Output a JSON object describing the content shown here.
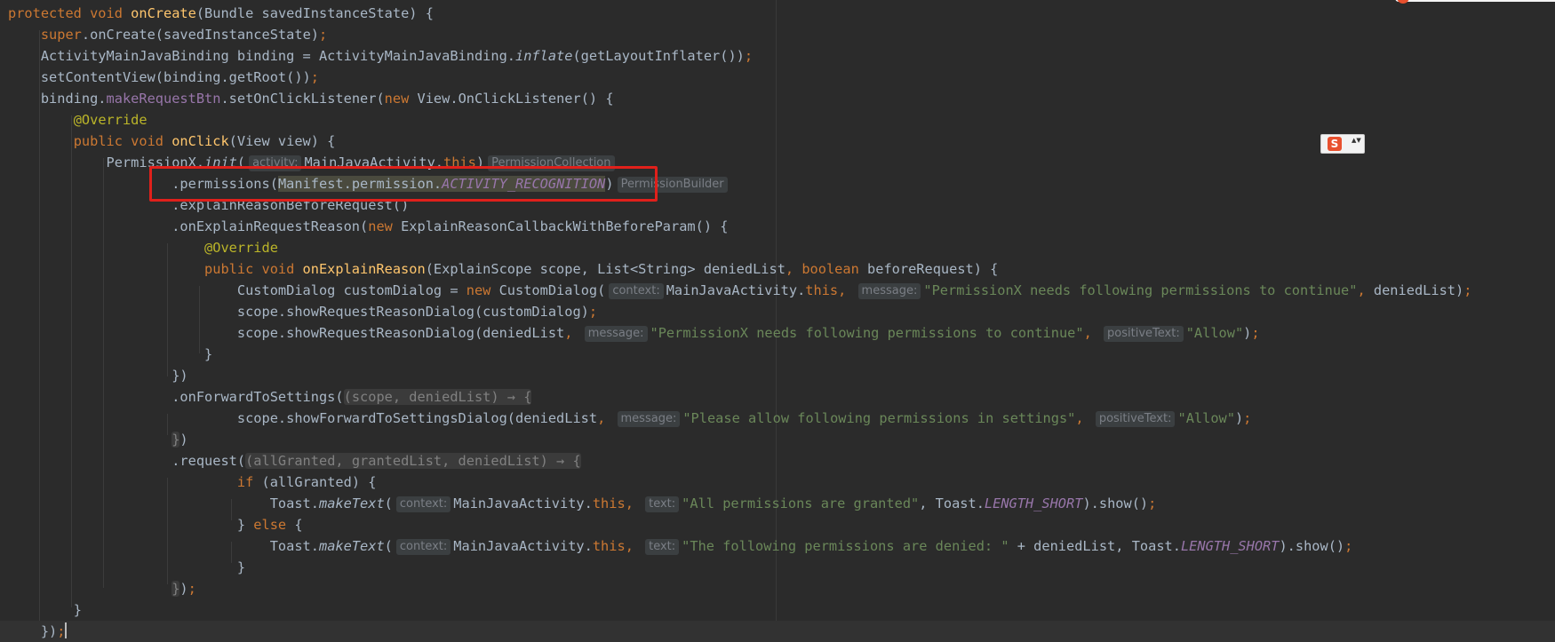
{
  "colors": {
    "background": "#2b2b2b",
    "keyword": "#cc7832",
    "method_declaration": "#ffc66d",
    "annotation": "#bbb529",
    "string": "#6a8759",
    "field": "#9876aa",
    "default_text": "#a9b7c6",
    "highlight_box": "#e0201b"
  },
  "code": {
    "l1": {
      "kw": "protected void ",
      "fn": "onCreate",
      "rest": "(Bundle savedInstanceState) {"
    },
    "l2": {
      "kw": "super",
      "rest": ".onCreate(savedInstanceState)",
      "semi": ";"
    },
    "l3": {
      "a": "ActivityMainJavaBinding binding = ActivityMainJavaBinding.",
      "it": "inflate",
      "b": "(getLayoutInflater())",
      "semi": ";"
    },
    "l4": {
      "a": "setContentView(binding.getRoot())",
      "semi": ";"
    },
    "l5": {
      "a": "binding.",
      "fld": "makeRequestBtn",
      "b": ".setOnClickListener(",
      "kw": "new ",
      "c": "View.OnClickListener() {"
    },
    "l6": {
      "ann": "@Override"
    },
    "l7": {
      "kw": "public void ",
      "fn": "onClick",
      "rest": "(View view) {"
    },
    "l8": {
      "a": "PermissionX.",
      "it": "init",
      "b": "(",
      "hint": "activity:",
      "c": "MainJavaActivity.",
      "kw": "this",
      "d": ")",
      "hint2": "PermissionCollection"
    },
    "l9": {
      "a": ".permissions(",
      "hl1": "Manifest.permission.",
      "cst": "ACTIVITY_RECOGNITION",
      "b": ")",
      "hint": "PermissionBuilder"
    },
    "l10": {
      "a": ".explainReasonBeforeRequest()"
    },
    "l11": {
      "a": ".onExplainRequestReason(",
      "kw": "new ",
      "b": "ExplainReasonCallbackWithBeforeParam() {"
    },
    "l12": {
      "ann": "@Override"
    },
    "l13": {
      "kw": "public void ",
      "fn": "onExplainReason",
      "a": "(ExplainScope scope, List<String> deniedList",
      "comma": ", ",
      "kw2": "boolean ",
      "b": "beforeRequest) {"
    },
    "l14": {
      "a": "CustomDialog customDialog = ",
      "kw": "new ",
      "b": "CustomDialog(",
      "hint": "context:",
      "c": "MainJavaActivity.",
      "kw2": "this",
      "comma": ", ",
      "hint2": "message:",
      "str": "\"PermissionX needs following permissions to continue\"",
      "comma2": ", ",
      "d": "deniedList)",
      "semi": ";"
    },
    "l15": {
      "a": "scope.showRequestReasonDialog(customDialog)",
      "semi": ";"
    },
    "l16": {
      "a": "scope.showRequestReasonDialog(deniedList",
      "comma": ", ",
      "hint": "message:",
      "str": "\"PermissionX needs following permissions to continue\"",
      "comma2": ", ",
      "hint2": "positiveText:",
      "str2": "\"Allow\"",
      "b": ")",
      "semi": ";"
    },
    "l17": {
      "a": "}"
    },
    "l18": {
      "a": "})"
    },
    "l19": {
      "a": ".onForwardToSettings(",
      "lam": "(scope, deniedList) → {"
    },
    "l20": {
      "a": "scope.showForwardToSettingsDialog(deniedList",
      "comma": ", ",
      "hint": "message:",
      "str": "\"Please allow following permissions in settings\"",
      "comma2": ", ",
      "hint2": "positiveText:",
      "str2": "\"Allow\"",
      "b": ")",
      "semi": ";"
    },
    "l21": {
      "lam": "}",
      "a": ")"
    },
    "l22": {
      "a": ".request(",
      "lam": "(allGranted, grantedList, deniedList) → {"
    },
    "l23": {
      "kw": "if ",
      "a": "(allGranted) {"
    },
    "l24": {
      "a": "Toast.",
      "it": "makeText",
      "b": "(",
      "hint": "context:",
      "c": "MainJavaActivity.",
      "kw": "this",
      "comma": ", ",
      "hint2": "text:",
      "str": "\"All permissions are granted\"",
      "d": ", Toast.",
      "cst": "LENGTH_SHORT",
      "e": ").show()",
      "semi": ";"
    },
    "l25": {
      "a": "} ",
      "kw": "else ",
      "b": "{"
    },
    "l26": {
      "a": "Toast.",
      "it": "makeText",
      "b": "(",
      "hint": "context:",
      "c": "MainJavaActivity.",
      "kw": "this",
      "comma": ", ",
      "hint2": "text:",
      "str": "\"The following permissions are denied: \"",
      "d": " + deniedList, Toast.",
      "cst": "LENGTH_SHORT",
      "e": ").show()",
      "semi": ";"
    },
    "l27": {
      "a": "}"
    },
    "l28": {
      "lam": "}",
      "a": ")",
      "semi": ";"
    },
    "l29": {
      "a": "}"
    },
    "l30": {
      "a": "})",
      "semi": ";"
    }
  },
  "ime": {
    "logo": "S",
    "arrows": "▲▼"
  }
}
